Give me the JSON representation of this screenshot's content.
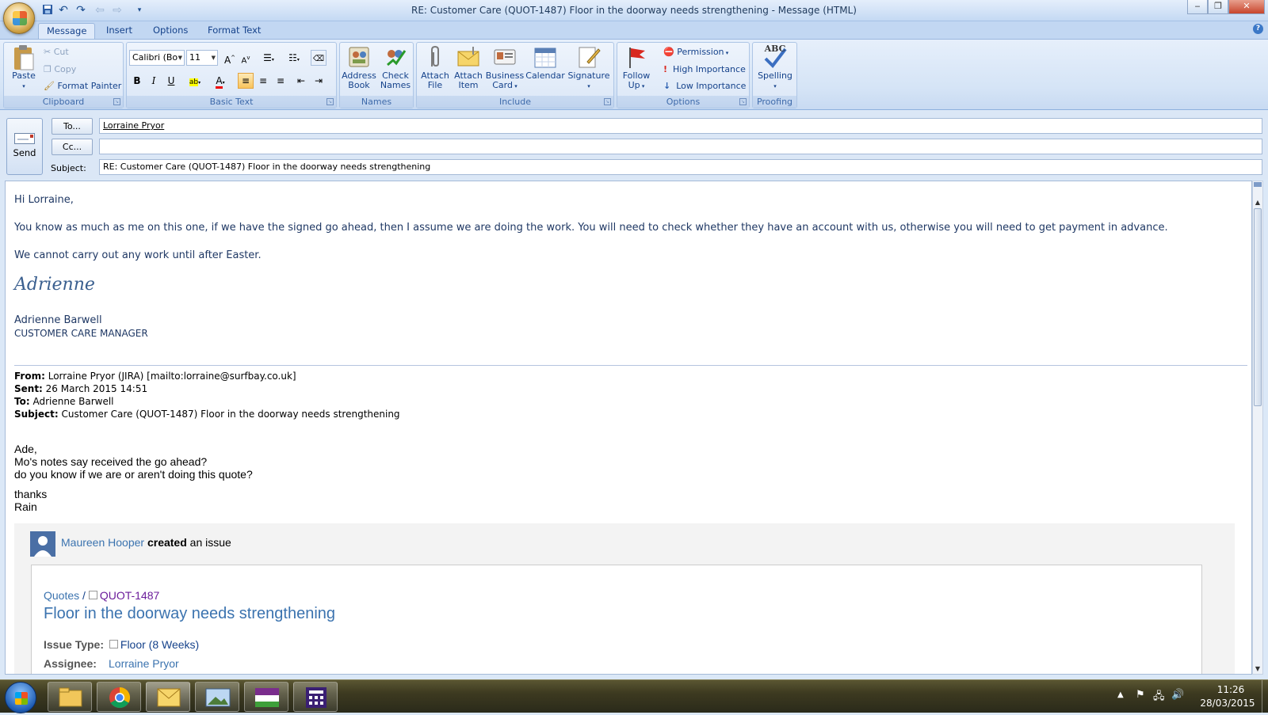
{
  "window": {
    "title": "RE: Customer Care (QUOT-1487) Floor in the doorway needs strengthening - Message (HTML)"
  },
  "qat": {
    "icons": [
      "save-icon",
      "undo-icon",
      "redo-icon",
      "previous-icon",
      "next-icon",
      "customize-icon"
    ]
  },
  "tabs": [
    "Message",
    "Insert",
    "Options",
    "Format Text"
  ],
  "active_tab": "Message",
  "ribbon": {
    "clipboard": {
      "label": "Clipboard",
      "paste": "Paste",
      "cut": "Cut",
      "copy": "Copy",
      "format_painter": "Format Painter"
    },
    "basic_text": {
      "label": "Basic Text",
      "font": "Calibri (Bo",
      "size": "11"
    },
    "names": {
      "label": "Names",
      "address_book_1": "Address",
      "address_book_2": "Book",
      "check_names_1": "Check",
      "check_names_2": "Names"
    },
    "include": {
      "label": "Include",
      "attach_file_1": "Attach",
      "attach_file_2": "File",
      "attach_item_1": "Attach",
      "attach_item_2": "Item",
      "business_card_1": "Business",
      "business_card_2": "Card",
      "calendar": "Calendar",
      "signature": "Signature"
    },
    "options": {
      "label": "Options",
      "follow_up_1": "Follow",
      "follow_up_2": "Up",
      "permission": "Permission",
      "high_importance": "High Importance",
      "low_importance": "Low Importance"
    },
    "proofing": {
      "label": "Proofing",
      "spelling": "Spelling",
      "abc": "ABC"
    }
  },
  "header": {
    "send": "Send",
    "to_button": "To...",
    "cc_button": "Cc...",
    "subject_label": "Subject:",
    "to_value": "Lorraine Pryor",
    "cc_value": "",
    "subject_value": "RE: Customer Care (QUOT-1487) Floor in the doorway needs strengthening"
  },
  "body": {
    "greeting": "Hi Lorraine,",
    "para1": "You know as much as me on this one, if we have the signed go ahead, then I assume we are doing the work.  You will need to check whether they have an account with us, otherwise you will need to get payment in advance.",
    "para2": "We cannot carry out any work until after Easter.",
    "signature_script": "Adrienne",
    "sig_name": "Adrienne Barwell",
    "sig_title": "CUSTOMER CARE MANAGER",
    "from_label": "From:",
    "from_value": " Lorraine Pryor (JIRA) [mailto:lorraine@surfbay.co.uk]",
    "sent_label": "Sent:",
    "sent_value": " 26 March 2015 14:51",
    "to_label": "To:",
    "to_value": " Adrienne Barwell",
    "subject_label": "Subject:",
    "subject_value": " Customer Care (QUOT-1487) Floor in the doorway needs strengthening",
    "quoted": {
      "line1": "Ade,",
      "line2": "Mo's notes say received the go ahead?",
      "line3": "do you know if we are or aren't doing this quote?",
      "line4": "thanks",
      "line5": "Rain"
    },
    "jira": {
      "user": "Maureen Hooper",
      "action": "created",
      "action_tail": " an issue",
      "breadcrumb_project": "Quotes",
      "breadcrumb_sep": " / ",
      "issue_key": "QUOT-1487",
      "issue_title": "Floor in the doorway needs strengthening",
      "issue_type_label": "Issue Type:",
      "issue_type_value": "Floor (8 Weeks)",
      "assignee_label": "Assignee:",
      "assignee_value": "Lorraine Pryor"
    }
  },
  "taskbar": {
    "apps": [
      "file-explorer-icon",
      "chrome-icon",
      "outlook-icon",
      "image-viewer-icon",
      "sage-icon",
      "calculator-icon"
    ],
    "time": "11:26",
    "date": "28/03/2015"
  },
  "colors": {
    "ribbon_text": "#15428b",
    "body_text": "#1f3864",
    "jira_link": "#3b73af",
    "jira_key": "#6a1b9a"
  }
}
